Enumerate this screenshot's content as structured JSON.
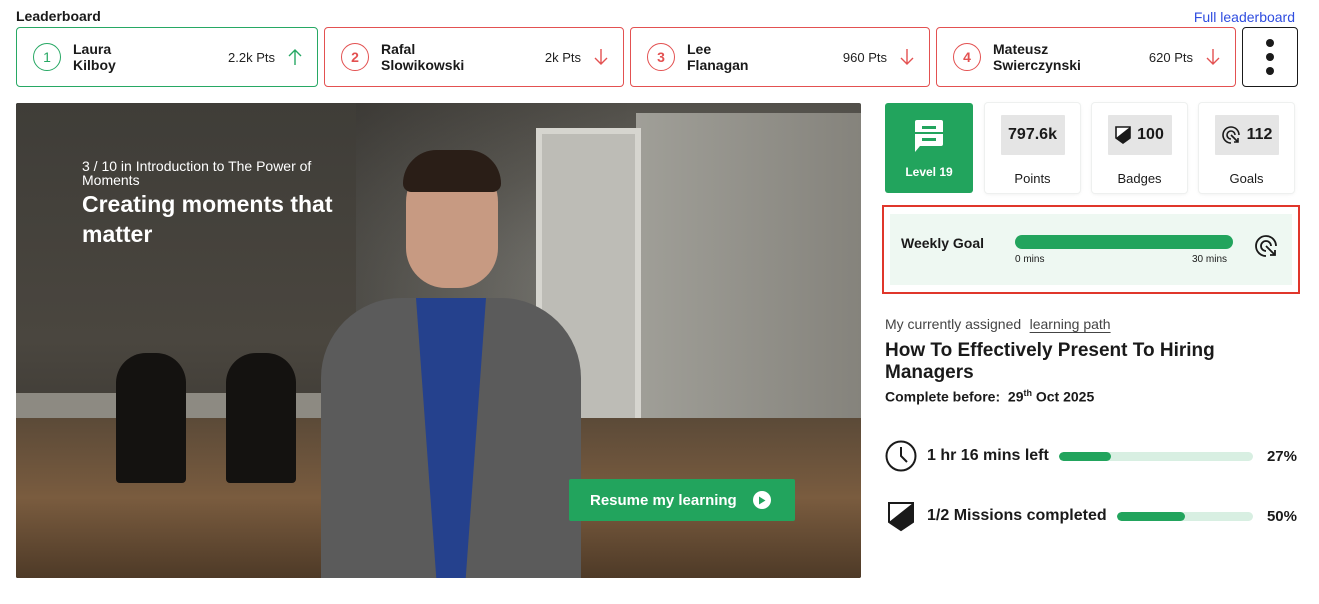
{
  "leaderboard": {
    "title": "Leaderboard",
    "full_link": "Full leaderboard",
    "entries": [
      {
        "rank": "1",
        "first": "Laura",
        "last": "Kilboy",
        "points": "2.2k Pts",
        "trend": "up"
      },
      {
        "rank": "2",
        "first": "Rafal",
        "last": "Slowikowski",
        "points": "2k Pts",
        "trend": "down"
      },
      {
        "rank": "3",
        "first": "Lee",
        "last": "Flanagan",
        "points": "960 Pts",
        "trend": "down"
      },
      {
        "rank": "4",
        "first": "Mateusz",
        "last": "Swierczynski",
        "points": "620 Pts",
        "trend": "down"
      }
    ]
  },
  "video": {
    "course_position": "3 / 10 in Introduction to The Power of Moments",
    "title": "Creating moments that matter",
    "resume_label": "Resume my learning"
  },
  "stats": {
    "level": "Level 19",
    "points_value": "797.6k",
    "points_label": "Points",
    "badges_value": "100",
    "badges_label": "Badges",
    "goals_value": "112",
    "goals_label": "Goals"
  },
  "weekly_goal": {
    "label": "Weekly Goal",
    "min": "0 mins",
    "max": "30 mins",
    "progress": 1.0
  },
  "assigned": {
    "prefix": "My currently assigned",
    "link": "learning path",
    "title": "How To Effectively Present To Hiring Managers",
    "complete_label": "Complete before:",
    "complete_day": "29",
    "complete_suffix": "th",
    "complete_rest": "Oct 2025"
  },
  "progress": {
    "time_label": "1 hr 16 mins left",
    "time_pct": "27%",
    "time_value": 27,
    "missions_label": "1/2 Missions completed",
    "missions_pct": "50%",
    "missions_value": 50
  },
  "colors": {
    "green": "#22a45d",
    "red": "#e35151",
    "link_blue": "#2f4de0",
    "highlight_red": "#e0362b"
  }
}
